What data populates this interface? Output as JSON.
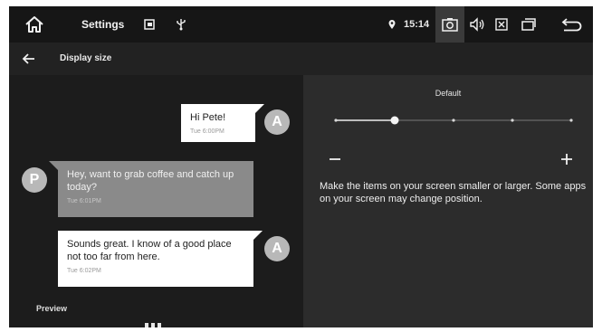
{
  "status_bar": {
    "title": "Settings",
    "time": "15:14",
    "icons": [
      "home-icon",
      "usb-storage-icon",
      "usb-icon",
      "location-icon",
      "camera-icon",
      "volume-icon",
      "close-box-icon",
      "window-icon",
      "back-icon"
    ]
  },
  "action_bar": {
    "back_icon": "arrow-left-icon",
    "title": "Display size"
  },
  "preview": {
    "label": "Preview",
    "messages": [
      {
        "sender": "A",
        "text": "Hi Pete!",
        "time": "Tue 6:00PM"
      },
      {
        "sender": "P",
        "text": "Hey, want to grab coffee and catch up today?",
        "time": "Tue 6:01PM"
      },
      {
        "sender": "A",
        "text": "Sounds great. I know of a good place not too far from here.",
        "time": "Tue 6:02PM"
      }
    ]
  },
  "settings": {
    "size_label": "Default",
    "slider": {
      "steps": 5,
      "selected_index": 1
    },
    "minus_label": "−",
    "plus_label": "+",
    "description": "Make the items on your screen smaller or larger. Some apps on your screen may change position."
  },
  "colors": {
    "status_bar_bg": "#161616",
    "preview_bg": "#1c1c1c",
    "settings_bg": "#2c2c2c",
    "bubble_light": "#ffffff",
    "bubble_dark": "#8a8a8a",
    "avatar": "#b8b8b8"
  }
}
